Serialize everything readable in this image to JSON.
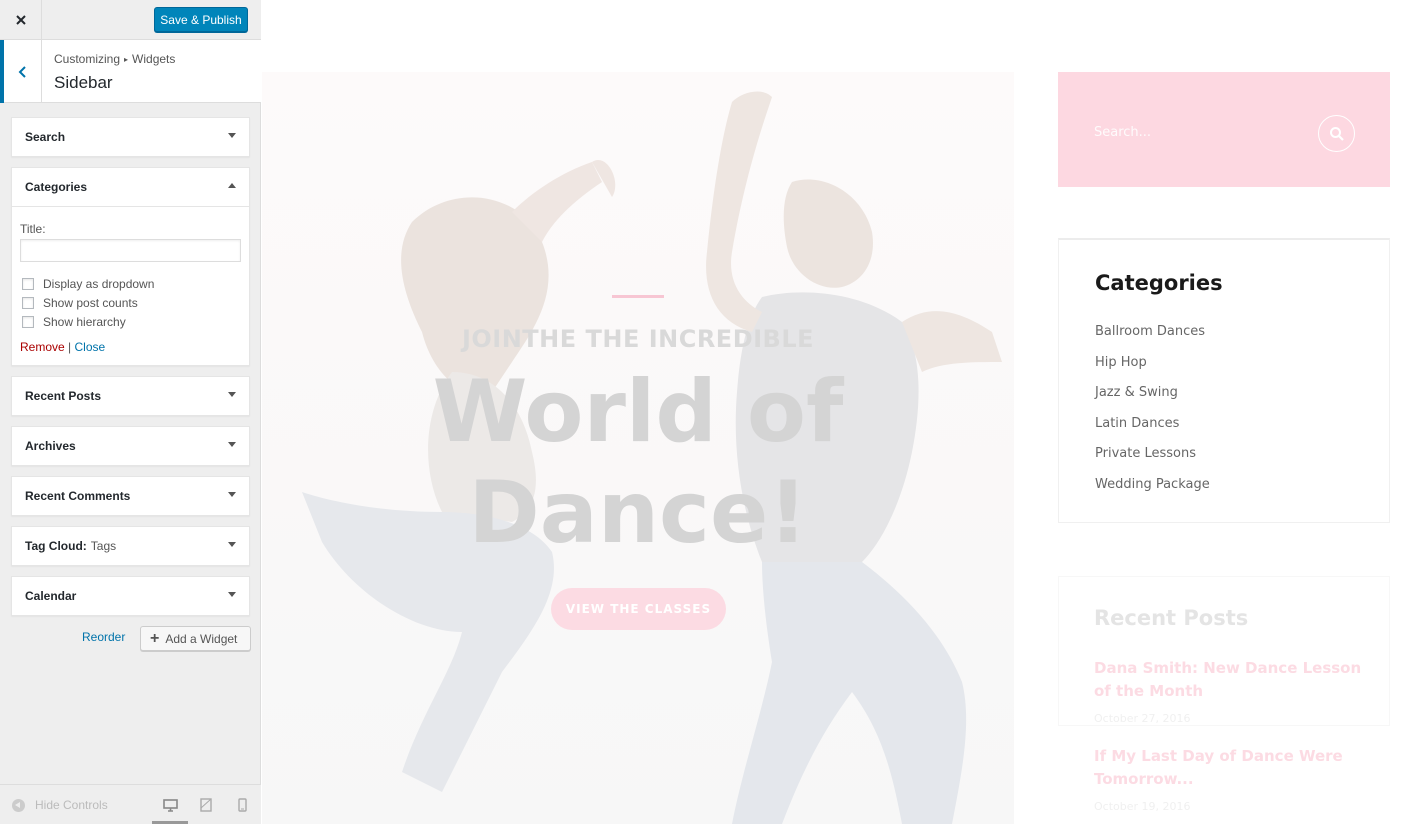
{
  "customizer": {
    "save_label": "Save & Publish",
    "breadcrumb": [
      "Customizing",
      "Widgets"
    ],
    "breadcrumb_sep": "▸",
    "section_title": "Sidebar",
    "widgets": [
      {
        "name": "Search"
      },
      {
        "name": "Categories",
        "expanded": true
      },
      {
        "name": "Recent Posts"
      },
      {
        "name": "Archives"
      },
      {
        "name": "Recent Comments"
      },
      {
        "name": "Tag Cloud:",
        "subtitle": "Tags"
      },
      {
        "name": "Calendar"
      }
    ],
    "categories_form": {
      "title_label": "Title:",
      "title_value": "",
      "options": [
        "Display as dropdown",
        "Show post counts",
        "Show hierarchy"
      ],
      "remove_label": "Remove",
      "divider": "|",
      "close_label": "Close"
    },
    "reorder_label": "Reorder",
    "add_widget_label": "Add a Widget",
    "hide_controls_label": "Hide Controls",
    "active_device": "desktop",
    "accent_color": "#0085ba"
  },
  "preview": {
    "hero": {
      "subtitle": "JOINTHE THE INCREDIBLE",
      "title_line1": "World of",
      "title_line2": "Dance!",
      "button_label": "VIEW THE CLASSES"
    },
    "search": {
      "placeholder": "Search..."
    },
    "categories": {
      "title": "Categories",
      "items": [
        "Ballroom Dances",
        "Hip Hop",
        "Jazz & Swing",
        "Latin Dances",
        "Private Lessons",
        "Wedding Package"
      ]
    },
    "recent_posts": {
      "title": "Recent Posts",
      "posts": [
        {
          "title": "Dana Smith: New Dance Lesson of the Month",
          "date": "October 27, 2016"
        },
        {
          "title": "If My Last Day of Dance Were Tomorrow...",
          "date": "October 19, 2016"
        }
      ]
    },
    "accent_color": "#fdd8e1"
  }
}
